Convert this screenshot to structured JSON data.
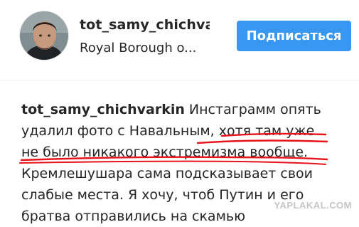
{
  "profile": {
    "username": "tot_samy_chichvar",
    "location": "Royal Borough o..."
  },
  "actions": {
    "follow_label": "Подписаться"
  },
  "caption": {
    "username": "tot_samy_chichvarkin",
    "line1_text": " Инстаграмм опять",
    "line2": "удалил фото с Навальным, хотя там уже",
    "line3": "не было никакого экстремизма вообще.",
    "line4": "Кремлешушара сама подсказывает свои",
    "line5": "слабые места. Я хочу, чтоб Путин и его",
    "line6": "братва отправились на скамью"
  },
  "watermark": {
    "text": "YAPLAKAL.COM"
  },
  "colors": {
    "follow_button": "#3897f0",
    "underline": "#e8141c",
    "text": "#262626"
  },
  "icons": {
    "avatar": "profile-photo"
  }
}
